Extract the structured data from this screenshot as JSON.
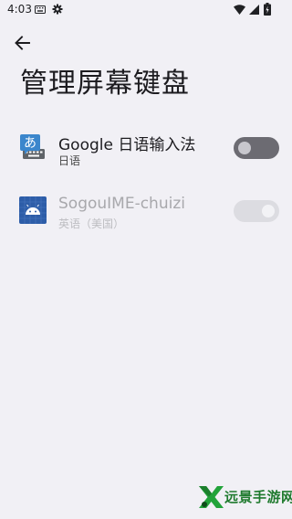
{
  "status_bar": {
    "time": "4:03",
    "icons": [
      "keyboard-icon",
      "gear-icon",
      "wifi-icon",
      "signal-icon",
      "battery-icon"
    ]
  },
  "header": {
    "back_icon": "arrow-left-icon",
    "title": "管理屏幕键盘"
  },
  "keyboards": [
    {
      "name": "Google 日语输入法",
      "subtitle": "日语",
      "icon": "google-japanese-input-icon",
      "enabled": false,
      "interactive": true
    },
    {
      "name": "SogouIME-chuizi",
      "subtitle": "英语（美国）",
      "icon": "android-app-icon",
      "enabled": true,
      "interactive": false
    }
  ],
  "watermark": {
    "text": "远景手游网"
  },
  "colors": {
    "background": "#f1f0f5",
    "toggle_off_track": "#6c6b72",
    "toggle_disabled_track": "#dcdce1",
    "watermark_green": "#1f7a2e",
    "app_icon_blue": "#2d5da8"
  }
}
